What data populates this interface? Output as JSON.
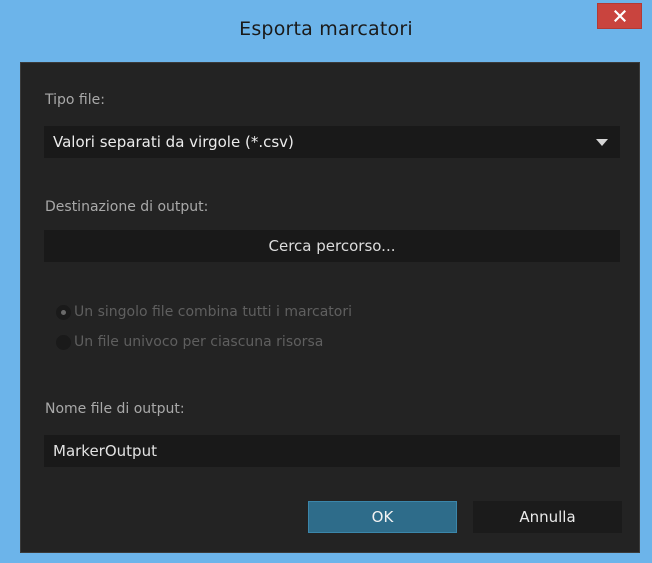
{
  "dialog": {
    "title": "Esporta marcatori",
    "close_icon": "close-icon"
  },
  "file_type": {
    "label": "Tipo file:",
    "selected": "Valori separati da virgole (*.csv)"
  },
  "output_destination": {
    "label": "Destinazione di output:",
    "browse_label": "Cerca percorso..."
  },
  "mode_options": [
    {
      "label": "Un singolo file combina tutti i marcatori",
      "selected": true,
      "enabled": false
    },
    {
      "label": "Un file univoco per ciascuna risorsa",
      "selected": false,
      "enabled": false
    }
  ],
  "output_filename": {
    "label": "Nome file di output:",
    "value": "MarkerOutput"
  },
  "buttons": {
    "ok_label": "OK",
    "cancel_label": "Annulla"
  },
  "colors": {
    "titlebar": "#6cb4ea",
    "close": "#c9443e",
    "panel": "#232323",
    "field": "#191919",
    "accent": "#2e6c8a"
  }
}
